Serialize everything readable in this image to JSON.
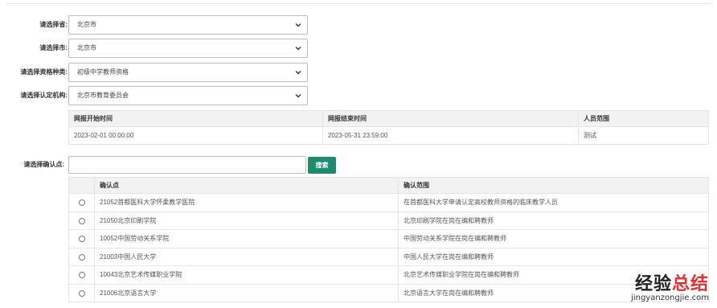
{
  "form": {
    "province": {
      "label": "请选择省:",
      "value": "北京市"
    },
    "city": {
      "label": "请选择市:",
      "value": "北京市"
    },
    "qualification": {
      "label": "请选择资格种类:",
      "value": "初级中学教师资格"
    },
    "agency": {
      "label": "请选择认定机构:",
      "value": "北京市教育委员会"
    }
  },
  "period_table": {
    "headers": [
      "网报开始时间",
      "网报结束时间",
      "人员范围"
    ],
    "row": [
      "2023-02-01 00:00:00",
      "2023-05-31 23:59:00",
      "测试"
    ]
  },
  "search": {
    "label": "请选择确认点:",
    "value": "",
    "button_label": "搜索"
  },
  "points_table": {
    "headers": [
      "",
      "确认点",
      "确认范围"
    ],
    "rows": [
      {
        "point": "21052首都医科大学怀柔教学医院",
        "scope": "在首都医科大学申请认定高校教师资格的临床教学人员"
      },
      {
        "point": "21050北京印刷学院",
        "scope": "北京印刷学院在岗在编和聘教师"
      },
      {
        "point": "10052中国劳动关系学院",
        "scope": "中国劳动关系学院在岗在编和聘教师"
      },
      {
        "point": "21003中国人民大学",
        "scope": "中国人民大学在岗在编和聘教师"
      },
      {
        "point": "10043北京艺术传媒职业学院",
        "scope": "北京艺术传媒职业学院在岗在编和聘教师"
      },
      {
        "point": "21006北京语言大学",
        "scope": "北京语言大学在岗在编和聘教师"
      }
    ]
  },
  "watermark": {
    "title_black": "经验",
    "title_red": "总结",
    "url": "jingyanzongjie.com"
  },
  "colors": {
    "button": "#1e8a6e",
    "header_bg": "#f2f2f2",
    "watermark_accent": "#dd3333"
  },
  "icons": {
    "select_arrow": "chevron-down-icon",
    "row_select": "radio-button"
  }
}
